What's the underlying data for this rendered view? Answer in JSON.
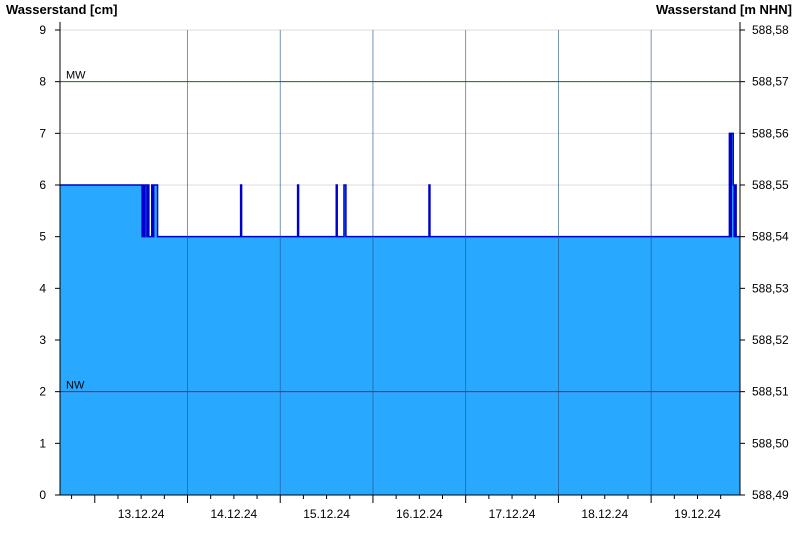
{
  "chart_data": {
    "type": "area",
    "ylabel_left": "Wasserstand [cm]",
    "ylabel_right": "Wasserstand [m NHN]",
    "ylim": [
      0,
      9
    ],
    "yticks": [
      "0",
      "1",
      "2",
      "3",
      "4",
      "5",
      "6",
      "7",
      "8",
      "9"
    ],
    "ylim_right": [
      588.49,
      588.58
    ],
    "yticks_right": [
      "588,49",
      "588,50",
      "588,51",
      "588,52",
      "588,53",
      "588,54",
      "588,55",
      "588,56",
      "588,57",
      "588,58"
    ],
    "xlim": [
      "2024-12-12T15:00",
      "2024-12-19T23:00"
    ],
    "xticks": [
      "13.12.24",
      "14.12.24",
      "15.12.24",
      "16.12.24",
      "17.12.24",
      "18.12.24",
      "19.12.24"
    ],
    "grid": true,
    "fill_color": "#29a8ff",
    "line_color": "#0000cc",
    "reference_lines": [
      {
        "label": "MW",
        "value": 8,
        "color": "#008000"
      },
      {
        "label": "NW",
        "value": 2,
        "color": "#cc0000"
      }
    ],
    "series": [
      {
        "x": [
          "2024-12-12T15:00",
          "2024-12-13T12:15",
          "2024-12-13T12:15",
          "2024-12-13T12:30",
          "2024-12-13T12:30",
          "2024-12-13T12:45",
          "2024-12-13T12:45",
          "2024-12-13T13:00",
          "2024-12-13T13:00",
          "2024-12-13T13:30",
          "2024-12-13T13:30",
          "2024-12-13T13:45",
          "2024-12-13T13:45",
          "2024-12-13T14:00",
          "2024-12-13T14:00",
          "2024-12-13T14:45",
          "2024-12-13T14:45",
          "2024-12-13T15:00",
          "2024-12-13T15:00",
          "2024-12-13T15:15",
          "2024-12-13T15:15",
          "2024-12-13T16:15",
          "2024-12-13T16:15",
          "2024-12-13T16:45",
          "2024-12-13T16:45",
          "2024-12-14T13:45",
          "2024-12-14T13:45",
          "2024-12-14T14:00",
          "2024-12-14T14:00",
          "2024-12-15T04:30",
          "2024-12-15T04:30",
          "2024-12-15T04:45",
          "2024-12-15T04:45",
          "2024-12-15T14:30",
          "2024-12-15T14:30",
          "2024-12-15T14:45",
          "2024-12-15T14:45",
          "2024-12-15T16:30",
          "2024-12-15T16:30",
          "2024-12-15T17:00",
          "2024-12-15T17:00",
          "2024-12-16T14:30",
          "2024-12-16T14:30",
          "2024-12-16T14:45",
          "2024-12-16T14:45",
          "2024-12-19T20:15",
          "2024-12-19T20:15",
          "2024-12-19T20:30",
          "2024-12-19T20:30",
          "2024-12-19T20:45",
          "2024-12-19T20:45",
          "2024-12-19T21:15",
          "2024-12-19T21:15",
          "2024-12-19T21:30",
          "2024-12-19T21:30",
          "2024-12-19T21:45",
          "2024-12-19T21:45",
          "2024-12-19T22:00",
          "2024-12-19T22:00",
          "2024-12-19T23:00"
        ],
        "values": [
          6,
          6,
          5,
          5,
          6,
          6,
          5,
          5,
          6,
          6,
          5,
          5,
          6,
          6,
          5,
          5,
          6,
          6,
          5,
          5,
          6,
          6,
          5,
          5,
          5,
          5,
          6,
          6,
          5,
          5,
          6,
          6,
          5,
          5,
          6,
          6,
          5,
          5,
          6,
          6,
          5,
          5,
          6,
          6,
          5,
          5,
          7,
          7,
          5,
          5,
          7,
          7,
          6,
          6,
          5,
          5,
          6,
          6,
          5,
          5
        ]
      }
    ]
  }
}
